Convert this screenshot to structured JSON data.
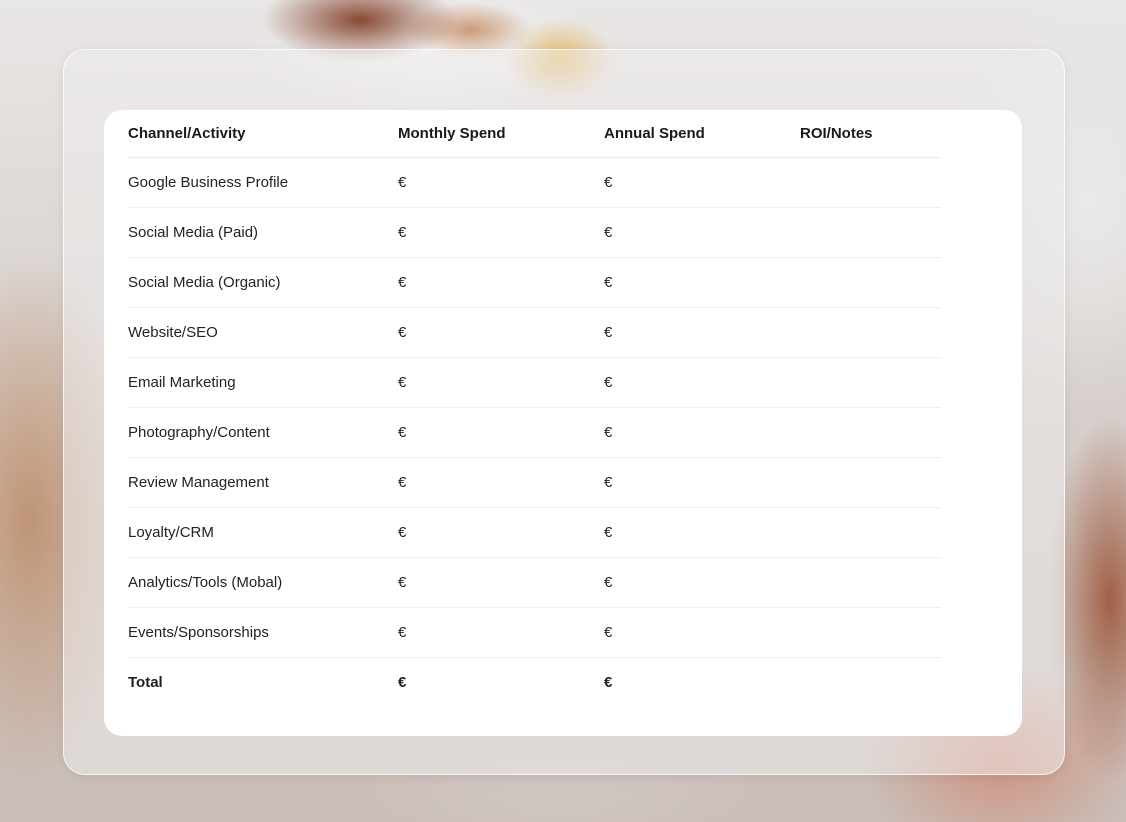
{
  "table": {
    "headers": [
      "Channel/Activity",
      "Monthly Spend",
      "Annual Spend",
      "ROI/Notes"
    ],
    "rows": [
      {
        "channel": "Google Business Profile",
        "monthly": "€",
        "annual": "€",
        "notes": ""
      },
      {
        "channel": "Social Media (Paid)",
        "monthly": "€",
        "annual": "€",
        "notes": ""
      },
      {
        "channel": "Social Media (Organic)",
        "monthly": "€",
        "annual": "€",
        "notes": ""
      },
      {
        "channel": "Website/SEO",
        "monthly": "€",
        "annual": "€",
        "notes": ""
      },
      {
        "channel": "Email Marketing",
        "monthly": "€",
        "annual": "€",
        "notes": ""
      },
      {
        "channel": "Photography/Content",
        "monthly": "€",
        "annual": "€",
        "notes": ""
      },
      {
        "channel": "Review Management",
        "monthly": "€",
        "annual": "€",
        "notes": ""
      },
      {
        "channel": "Loyalty/CRM",
        "monthly": "€",
        "annual": "€",
        "notes": ""
      },
      {
        "channel": "Analytics/Tools (Mobal)",
        "monthly": "€",
        "annual": "€",
        "notes": ""
      },
      {
        "channel": "Events/Sponsorships",
        "monthly": "€",
        "annual": "€",
        "notes": ""
      }
    ],
    "total": {
      "channel": "Total",
      "monthly": "€",
      "annual": "€",
      "notes": ""
    }
  }
}
